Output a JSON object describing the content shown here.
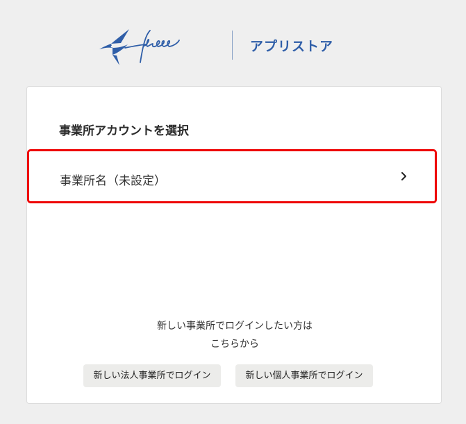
{
  "header": {
    "logo_text": "freee",
    "app_title": "アプリストア"
  },
  "card": {
    "title": "事業所アカウントを選択",
    "accounts": [
      {
        "label": "事業所名（未設定）"
      }
    ],
    "new_office_text_line1": "新しい事業所でログインしたい方は",
    "new_office_text_line2": "こちらから",
    "buttons": {
      "corporate_login": "新しい法人事業所でログイン",
      "individual_login": "新しい個人事業所でログイン"
    }
  },
  "colors": {
    "brand_blue": "#2f5ea8",
    "highlight_red": "#ee0000",
    "page_background": "#efefef",
    "button_background": "#ececea"
  },
  "icons": {
    "logo": "freee-swallow-logo",
    "account_arrow": "chevron-right-icon"
  }
}
